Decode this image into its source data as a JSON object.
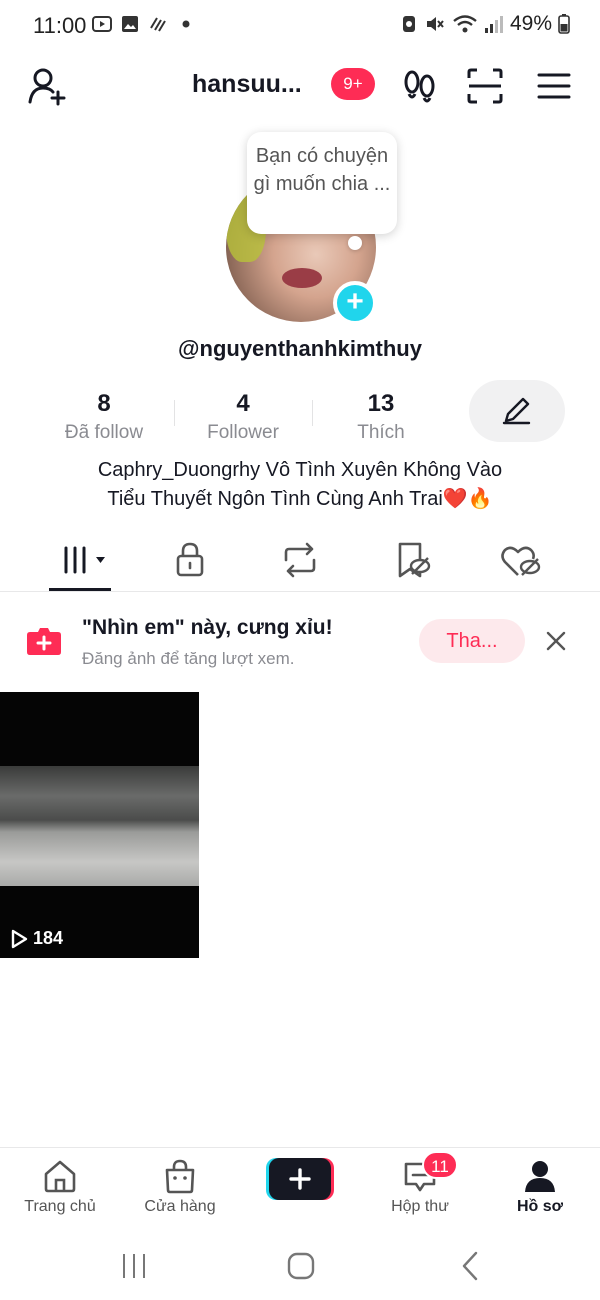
{
  "status_bar": {
    "time": "11:00",
    "battery": "49%"
  },
  "header": {
    "username": "hansuu...",
    "notification_badge": "9+"
  },
  "profile": {
    "bubble_text": "Bạn có chuyện gì muốn chia ...",
    "handle": "@nguyenthanhkimthuy",
    "stats": [
      {
        "value": "8",
        "label": "Đã follow"
      },
      {
        "value": "4",
        "label": "Follower"
      },
      {
        "value": "13",
        "label": "Thích"
      }
    ],
    "bio_line1": "Caphry_Duongrhy Vô Tình Xuyên Không Vào",
    "bio_line2": "Tiểu Thuyết Ngôn Tình Cùng Anh Trai❤️🔥"
  },
  "tabs": [
    {
      "icon": "grid-icon",
      "active": true
    },
    {
      "icon": "lock-icon"
    },
    {
      "icon": "repost-icon"
    },
    {
      "icon": "saved-hidden-icon"
    },
    {
      "icon": "liked-hidden-icon"
    }
  ],
  "banner": {
    "title": "\"Nhìn em\" này, cưng xỉu!",
    "subtitle": "Đăng ảnh để tăng lượt xem.",
    "button": "Tha..."
  },
  "videos": [
    {
      "views": "184"
    }
  ],
  "bottom_nav": {
    "home": "Trang chủ",
    "shop": "Cửa hàng",
    "inbox": "Hộp thư",
    "inbox_badge": "11",
    "profile": "Hồ sơ"
  },
  "colors": {
    "accent": "#fe2c55",
    "cyan": "#20d5ec",
    "text": "#161823",
    "muted": "#8a8b91"
  }
}
